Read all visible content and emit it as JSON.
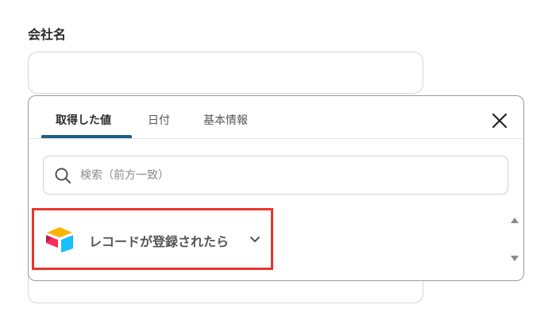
{
  "field": {
    "label": "会社名"
  },
  "popup": {
    "tabs": [
      {
        "label": "取得した値"
      },
      {
        "label": "日付"
      },
      {
        "label": "基本情報"
      }
    ],
    "search": {
      "placeholder": "検索（前方一致）"
    },
    "trigger": {
      "label": "レコードが登録されたら",
      "icon": "airtable-logo-icon"
    }
  },
  "colors": {
    "accent": "#1d5f85",
    "highlight": "#e8352b"
  }
}
